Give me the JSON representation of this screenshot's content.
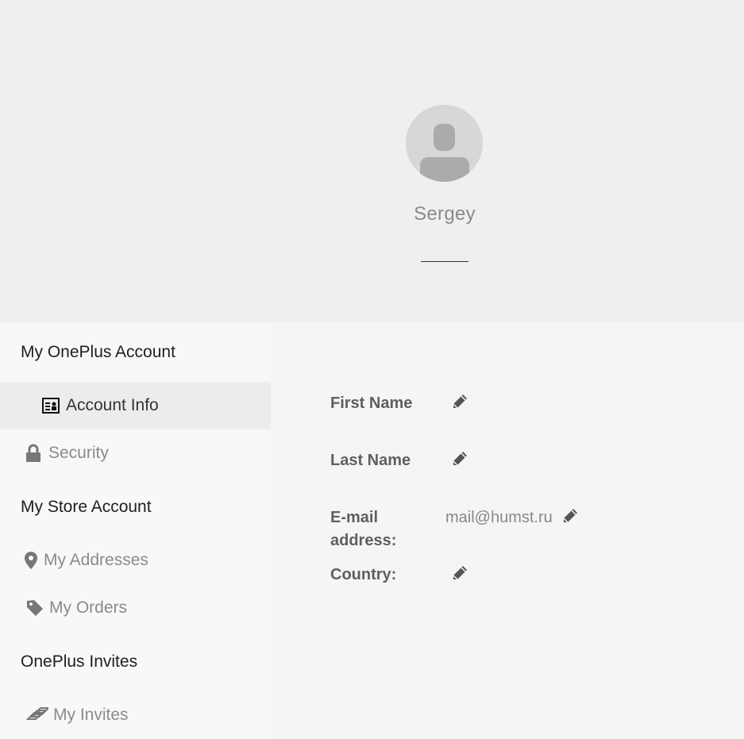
{
  "profile": {
    "username": "Sergey"
  },
  "sidebar": {
    "sections": [
      {
        "title": "My OnePlus Account"
      },
      {
        "title": "My Store Account"
      },
      {
        "title": "OnePlus Invites"
      }
    ],
    "items": [
      {
        "label": "Account Info",
        "icon": "id-card-icon",
        "active": true
      },
      {
        "label": "Security",
        "icon": "lock-icon"
      },
      {
        "label": "My Addresses",
        "icon": "map-pin-icon"
      },
      {
        "label": "My Orders",
        "icon": "tag-icon"
      },
      {
        "label": "My Invites",
        "icon": "tickets-icon"
      }
    ]
  },
  "account_info": {
    "fields": [
      {
        "label": "First Name",
        "value": ""
      },
      {
        "label": "Last Name",
        "value": ""
      },
      {
        "label": "E-mail address:",
        "value": "mail@humst.ru"
      },
      {
        "label": "Country:",
        "value": ""
      }
    ]
  },
  "colors": {
    "header_bg": "#efefef",
    "sidebar_bg": "#f9f7f7",
    "active_item_bg": "#ececec",
    "label_text": "#5f5f5f",
    "muted_text": "#8b8b8b"
  }
}
